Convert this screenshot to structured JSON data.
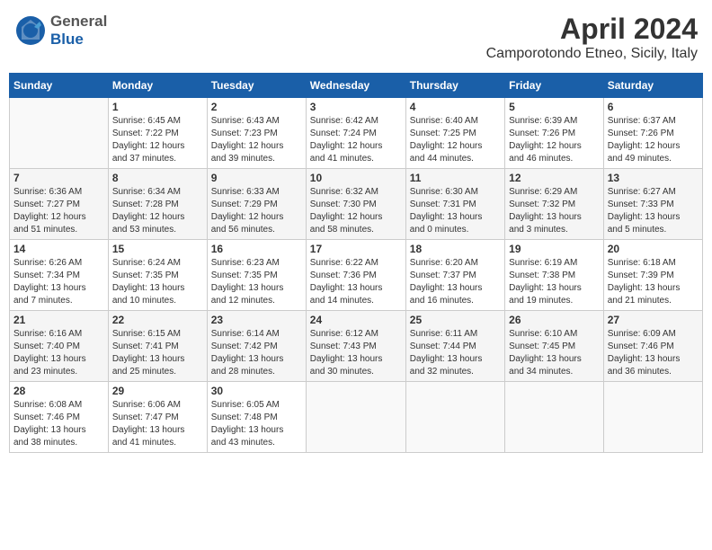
{
  "header": {
    "logo_general": "General",
    "logo_blue": "Blue",
    "month_title": "April 2024",
    "location": "Camporotondo Etneo, Sicily, Italy"
  },
  "weekdays": [
    "Sunday",
    "Monday",
    "Tuesday",
    "Wednesday",
    "Thursday",
    "Friday",
    "Saturday"
  ],
  "weeks": [
    [
      {
        "day": "",
        "info": ""
      },
      {
        "day": "1",
        "info": "Sunrise: 6:45 AM\nSunset: 7:22 PM\nDaylight: 12 hours\nand 37 minutes."
      },
      {
        "day": "2",
        "info": "Sunrise: 6:43 AM\nSunset: 7:23 PM\nDaylight: 12 hours\nand 39 minutes."
      },
      {
        "day": "3",
        "info": "Sunrise: 6:42 AM\nSunset: 7:24 PM\nDaylight: 12 hours\nand 41 minutes."
      },
      {
        "day": "4",
        "info": "Sunrise: 6:40 AM\nSunset: 7:25 PM\nDaylight: 12 hours\nand 44 minutes."
      },
      {
        "day": "5",
        "info": "Sunrise: 6:39 AM\nSunset: 7:26 PM\nDaylight: 12 hours\nand 46 minutes."
      },
      {
        "day": "6",
        "info": "Sunrise: 6:37 AM\nSunset: 7:26 PM\nDaylight: 12 hours\nand 49 minutes."
      }
    ],
    [
      {
        "day": "7",
        "info": "Sunrise: 6:36 AM\nSunset: 7:27 PM\nDaylight: 12 hours\nand 51 minutes."
      },
      {
        "day": "8",
        "info": "Sunrise: 6:34 AM\nSunset: 7:28 PM\nDaylight: 12 hours\nand 53 minutes."
      },
      {
        "day": "9",
        "info": "Sunrise: 6:33 AM\nSunset: 7:29 PM\nDaylight: 12 hours\nand 56 minutes."
      },
      {
        "day": "10",
        "info": "Sunrise: 6:32 AM\nSunset: 7:30 PM\nDaylight: 12 hours\nand 58 minutes."
      },
      {
        "day": "11",
        "info": "Sunrise: 6:30 AM\nSunset: 7:31 PM\nDaylight: 13 hours\nand 0 minutes."
      },
      {
        "day": "12",
        "info": "Sunrise: 6:29 AM\nSunset: 7:32 PM\nDaylight: 13 hours\nand 3 minutes."
      },
      {
        "day": "13",
        "info": "Sunrise: 6:27 AM\nSunset: 7:33 PM\nDaylight: 13 hours\nand 5 minutes."
      }
    ],
    [
      {
        "day": "14",
        "info": "Sunrise: 6:26 AM\nSunset: 7:34 PM\nDaylight: 13 hours\nand 7 minutes."
      },
      {
        "day": "15",
        "info": "Sunrise: 6:24 AM\nSunset: 7:35 PM\nDaylight: 13 hours\nand 10 minutes."
      },
      {
        "day": "16",
        "info": "Sunrise: 6:23 AM\nSunset: 7:35 PM\nDaylight: 13 hours\nand 12 minutes."
      },
      {
        "day": "17",
        "info": "Sunrise: 6:22 AM\nSunset: 7:36 PM\nDaylight: 13 hours\nand 14 minutes."
      },
      {
        "day": "18",
        "info": "Sunrise: 6:20 AM\nSunset: 7:37 PM\nDaylight: 13 hours\nand 16 minutes."
      },
      {
        "day": "19",
        "info": "Sunrise: 6:19 AM\nSunset: 7:38 PM\nDaylight: 13 hours\nand 19 minutes."
      },
      {
        "day": "20",
        "info": "Sunrise: 6:18 AM\nSunset: 7:39 PM\nDaylight: 13 hours\nand 21 minutes."
      }
    ],
    [
      {
        "day": "21",
        "info": "Sunrise: 6:16 AM\nSunset: 7:40 PM\nDaylight: 13 hours\nand 23 minutes."
      },
      {
        "day": "22",
        "info": "Sunrise: 6:15 AM\nSunset: 7:41 PM\nDaylight: 13 hours\nand 25 minutes."
      },
      {
        "day": "23",
        "info": "Sunrise: 6:14 AM\nSunset: 7:42 PM\nDaylight: 13 hours\nand 28 minutes."
      },
      {
        "day": "24",
        "info": "Sunrise: 6:12 AM\nSunset: 7:43 PM\nDaylight: 13 hours\nand 30 minutes."
      },
      {
        "day": "25",
        "info": "Sunrise: 6:11 AM\nSunset: 7:44 PM\nDaylight: 13 hours\nand 32 minutes."
      },
      {
        "day": "26",
        "info": "Sunrise: 6:10 AM\nSunset: 7:45 PM\nDaylight: 13 hours\nand 34 minutes."
      },
      {
        "day": "27",
        "info": "Sunrise: 6:09 AM\nSunset: 7:46 PM\nDaylight: 13 hours\nand 36 minutes."
      }
    ],
    [
      {
        "day": "28",
        "info": "Sunrise: 6:08 AM\nSunset: 7:46 PM\nDaylight: 13 hours\nand 38 minutes."
      },
      {
        "day": "29",
        "info": "Sunrise: 6:06 AM\nSunset: 7:47 PM\nDaylight: 13 hours\nand 41 minutes."
      },
      {
        "day": "30",
        "info": "Sunrise: 6:05 AM\nSunset: 7:48 PM\nDaylight: 13 hours\nand 43 minutes."
      },
      {
        "day": "",
        "info": ""
      },
      {
        "day": "",
        "info": ""
      },
      {
        "day": "",
        "info": ""
      },
      {
        "day": "",
        "info": ""
      }
    ]
  ]
}
